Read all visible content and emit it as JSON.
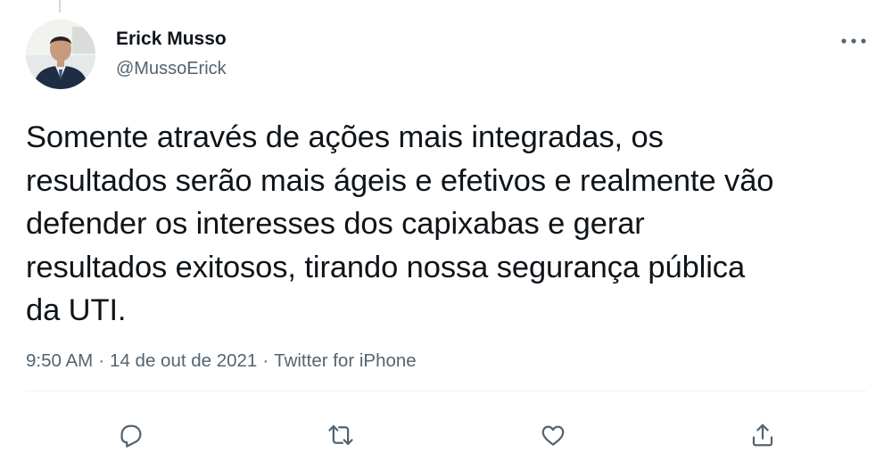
{
  "author": {
    "display_name": "Erick Musso",
    "handle": "@MussoErick"
  },
  "tweet": {
    "text_lines": [
      "Somente através de ações mais integradas, os",
      "resultados serão mais ágeis e efetivos e realmente vão",
      "defender os interesses dos capixabas e gerar",
      "resultados exitosos, tirando nossa segurança pública",
      "da UTI."
    ]
  },
  "meta": {
    "time": "9:50 AM",
    "date": "14 de out de 2021",
    "source": "Twitter for iPhone",
    "separator": "·"
  },
  "icons": {
    "more": "more-horizontal-icon",
    "reply": "reply-icon",
    "retweet": "retweet-icon",
    "like": "like-icon",
    "share": "share-icon"
  },
  "colors": {
    "text": "#0f1419",
    "secondary": "#536471",
    "icon": "#536471"
  }
}
